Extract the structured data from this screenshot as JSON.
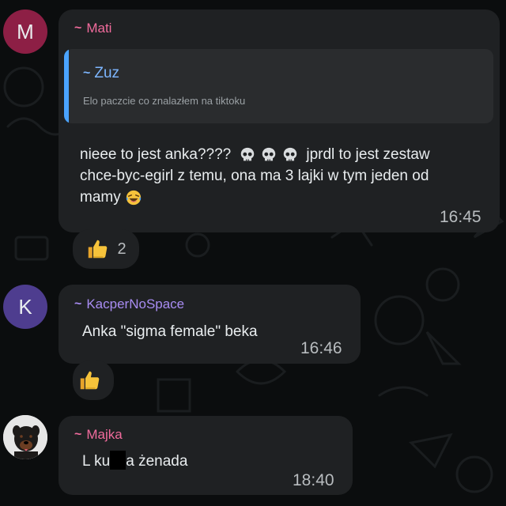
{
  "colors": {
    "background": "#0b0d0e",
    "bubble": "#1f2123",
    "quote_bg": "#2a2c2e",
    "quote_bar": "#4aa3ff",
    "mati_color": "#f06b9c",
    "zuz_color": "#7db6ff",
    "kacper_color": "#a88cf2",
    "majka_color": "#f06b9c"
  },
  "messages": [
    {
      "avatar_letter": "M",
      "sender": "Mati",
      "quote": {
        "sender": "Zuz",
        "text": "Elo paczcie co znalazłem na tiktoku"
      },
      "text_line1": "nieee to jest anka????",
      "text_line1b": "jprdl to jest zestaw",
      "text_line2": "chce-byc-egirl z temu, ona ma 3 lajki w tym jeden od",
      "text_line3": "mamy",
      "time": "16:45",
      "reaction": {
        "icon": "thumbs-up-icon",
        "count": "2"
      }
    },
    {
      "avatar_letter": "K",
      "sender": "KacperNoSpace",
      "text": "Anka \"sigma female\" beka",
      "time": "16:46",
      "reaction": {
        "icon": "thumbs-up-icon",
        "count": ""
      }
    },
    {
      "avatar_letter": "",
      "sender": "Majka",
      "text_prefix": "L ku",
      "text_suffix": "a żenada",
      "time": "18:40"
    }
  ]
}
